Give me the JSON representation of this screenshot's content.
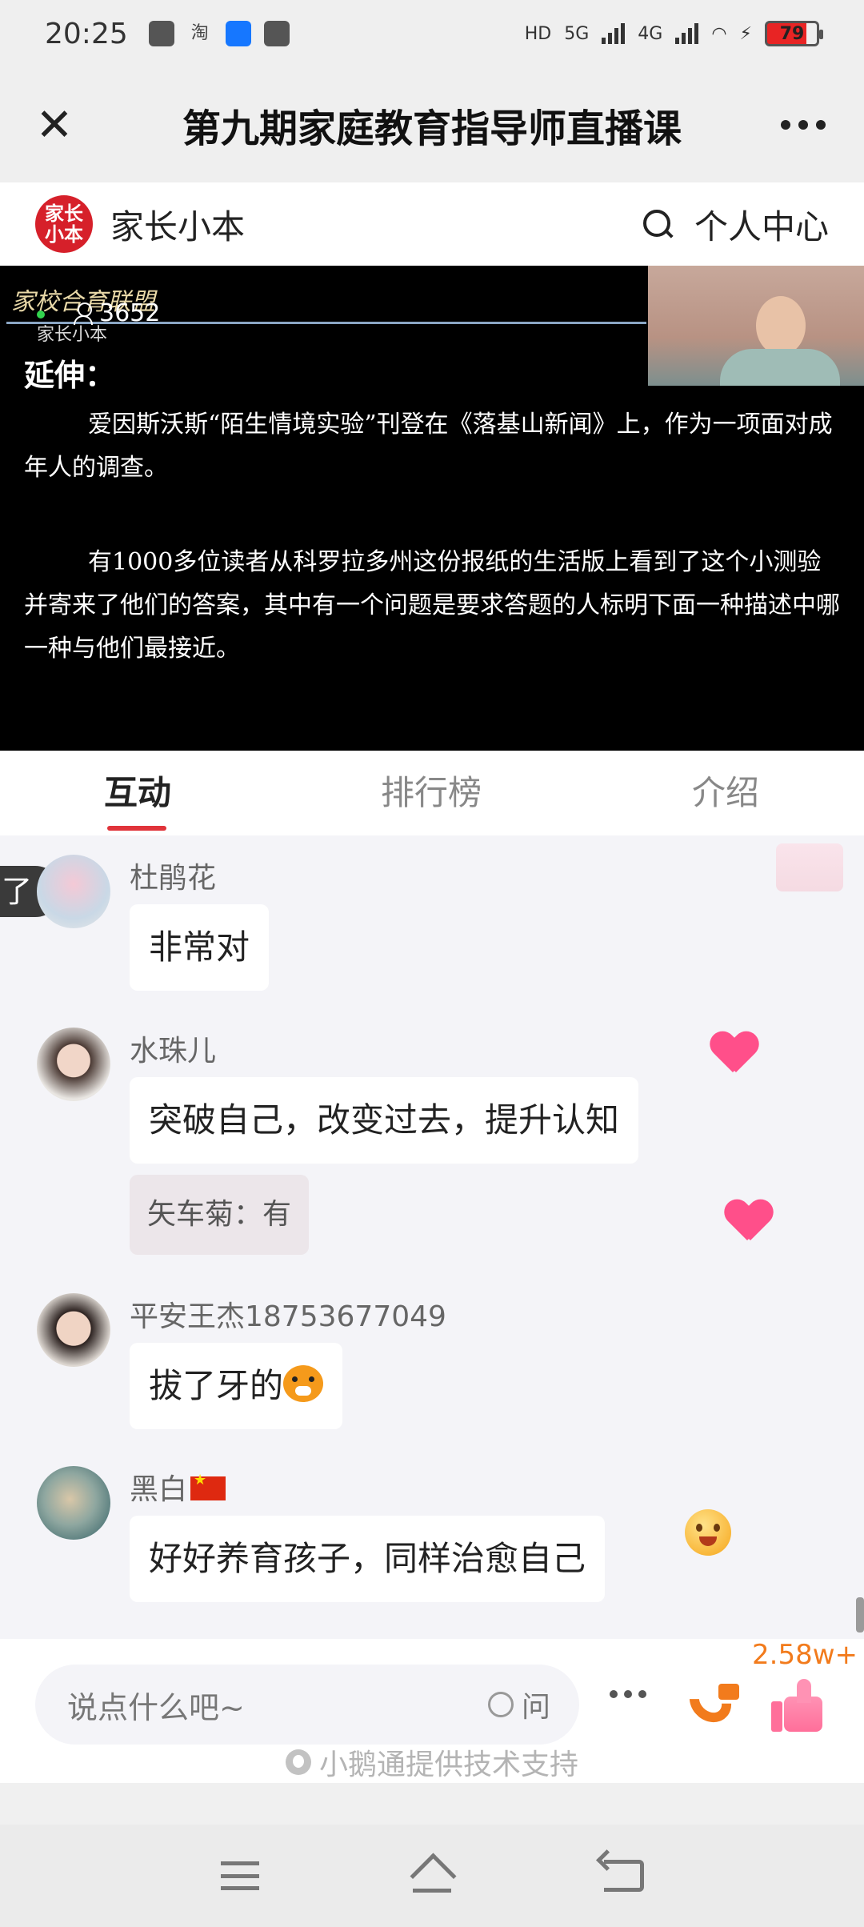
{
  "status_bar": {
    "time": "20:25",
    "network1": "5G",
    "network2": "4G",
    "battery": "79"
  },
  "window": {
    "title": "第九期家庭教育指导师直播课"
  },
  "brand": {
    "logo_text": "家长小本",
    "name": "家长小本",
    "personal_center": "个人中心"
  },
  "video": {
    "watermark": "家校合育联盟",
    "watermark_sub": "家长小本",
    "viewers": "3652",
    "heading": "延伸：",
    "paragraph1": "爱因斯沃斯“陌生情境实验”刊登在《落基山新闻》上，作为一项面对成年人的调查。",
    "paragraph2": "有1000多位读者从科罗拉多州这份报纸的生活版上看到了这个小测验并寄来了他们的答案，其中有一个问题是要求答题的人标明下面一种描述中哪一种与他们最接近。"
  },
  "tabs": [
    {
      "label": "互动"
    },
    {
      "label": "排行榜"
    },
    {
      "label": "介绍"
    }
  ],
  "chat": {
    "side_tag": "了",
    "messages": [
      {
        "user": "杜鹃花",
        "text": "非常对"
      },
      {
        "user": "水珠儿",
        "text": "突破自己，改变过去，提升认知",
        "reply": "矢车菊：有"
      },
      {
        "user": "平安王杰18753677049",
        "text": "拔了牙的"
      },
      {
        "user": "黑白",
        "text": "好好养育孩子，同样治愈自己"
      }
    ]
  },
  "input_bar": {
    "placeholder": "说点什么吧~",
    "ask_label": "问",
    "likes_count": "2.58w+",
    "powered_by": "小鹅通提供技术支持"
  },
  "colors": {
    "accent": "#e0333a",
    "like_orange": "#f27b1c",
    "heart": "#ff4f8a"
  }
}
